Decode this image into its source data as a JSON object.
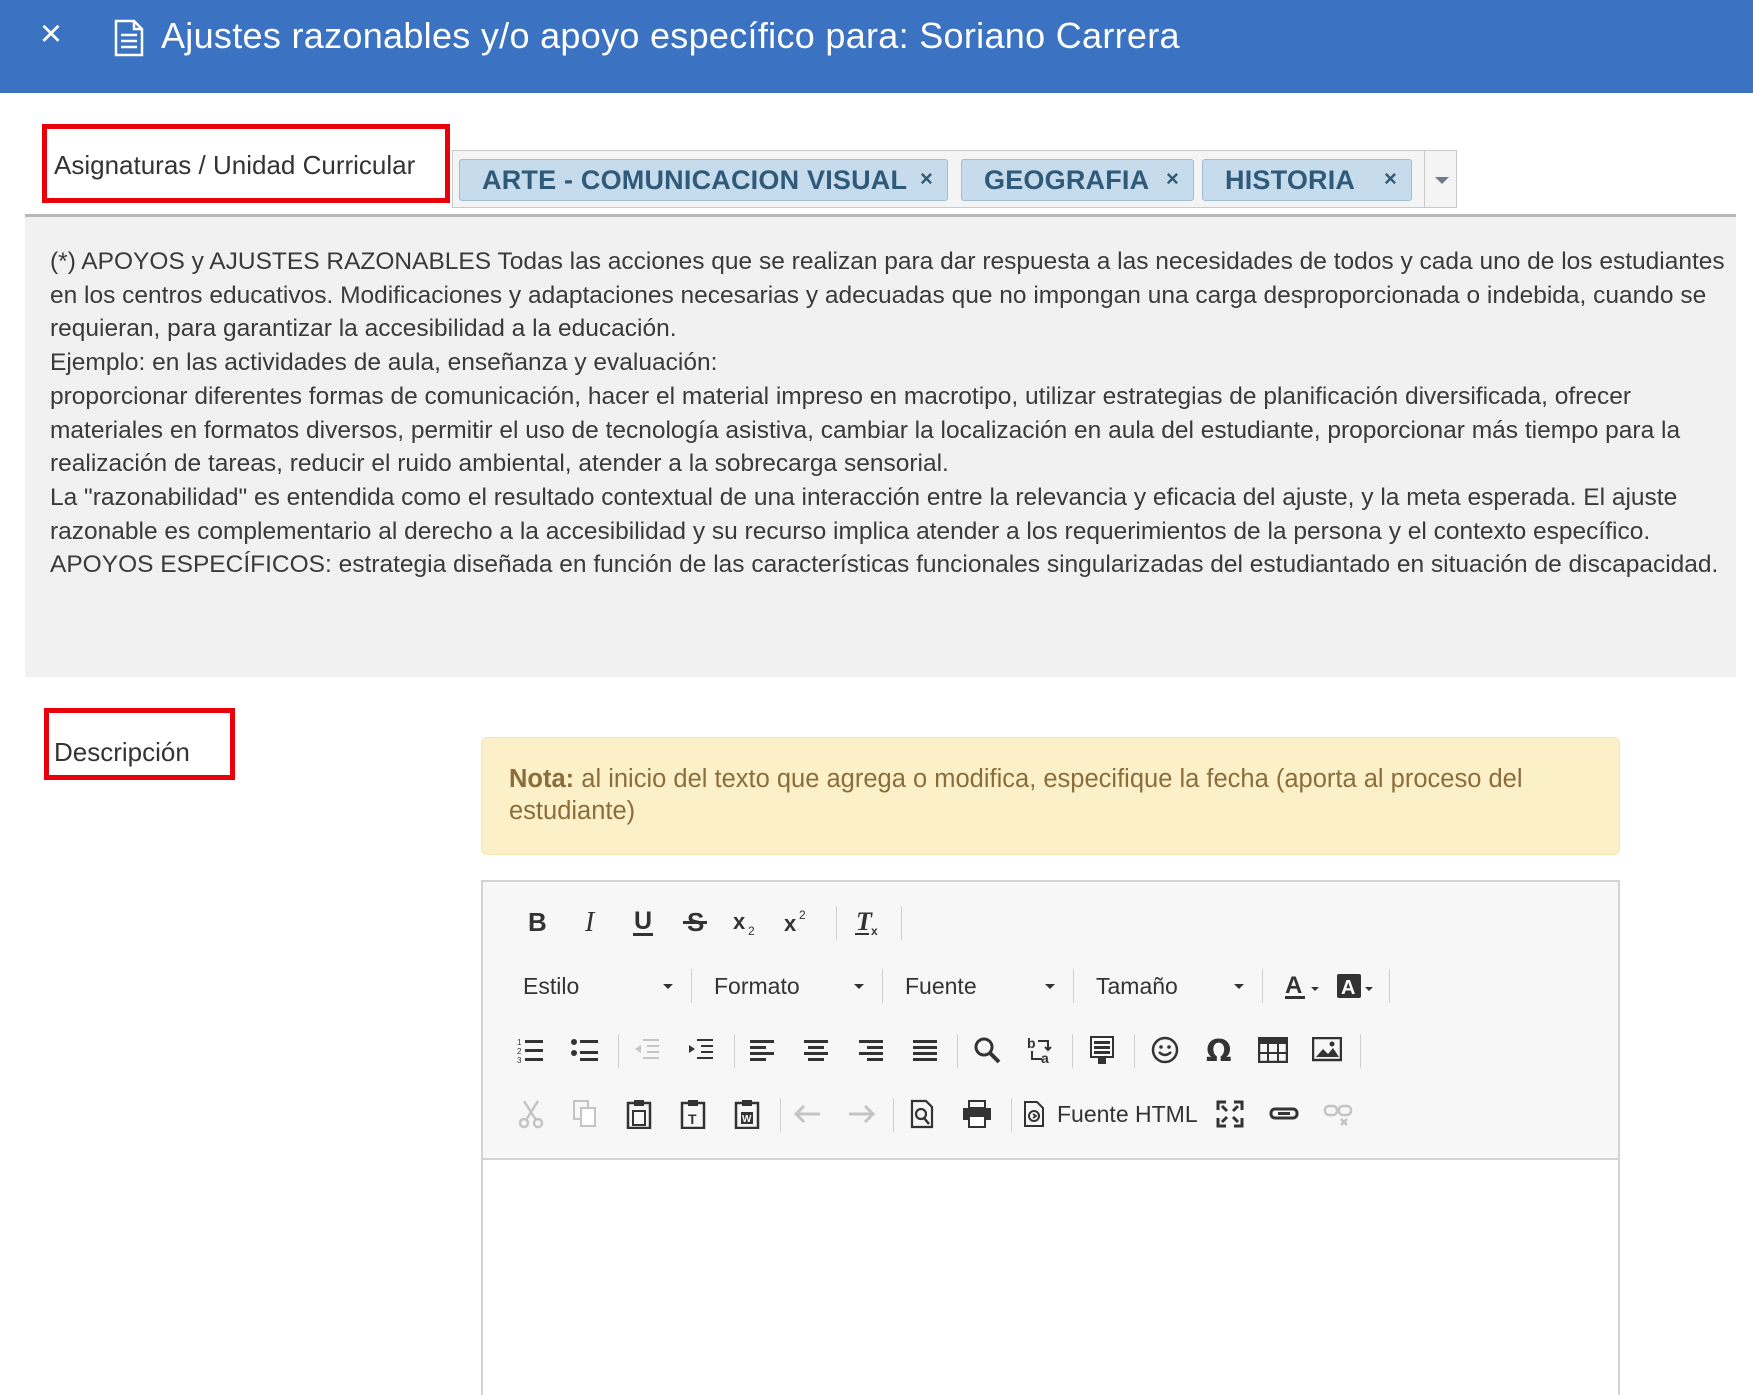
{
  "header": {
    "title": "Ajustes razonables y/o apoyo específico para:  Soriano Carrera",
    "close_glyph": "×",
    "background": "#3b73c2"
  },
  "subjects_field": {
    "label": "Asignaturas / Unidad Curricular",
    "chips": [
      {
        "label": "ARTE - COMUNICACION VISUAL",
        "remove": "×"
      },
      {
        "label": "GEOGRAFIA",
        "remove": "×"
      },
      {
        "label": "HISTORIA",
        "remove": "×"
      }
    ]
  },
  "info": {
    "paragraphs": [
      "(*) APOYOS y AJUSTES RAZONABLES Todas las acciones que se realizan para dar respuesta a las necesidades de todos y cada uno de los estudiantes en los centros educativos. Modificaciones y adaptaciones necesarias y adecuadas que no impongan una carga desproporcionada o indebida, cuando se requieran, para garantizar la accesibilidad a la educación.",
      "Ejemplo: en las actividades de aula, enseñanza y evaluación:",
      "proporcionar diferentes formas de comunicación, hacer el material impreso en macrotipo, utilizar estrategias de planificación diversificada, ofrecer materiales en formatos diversos, permitir el uso de tecnología asistiva, cambiar la localización en aula del estudiante, proporcionar más tiempo para la realización de tareas, reducir el ruido ambiental, atender a la sobrecarga sensorial.",
      "La \"razonabilidad\" es entendida como el resultado contextual de una interacción entre la relevancia y eficacia del ajuste, y la meta esperada. El ajuste razonable es complementario al derecho a la accesibilidad y su recurso implica atender a los requerimientos de la persona y el contexto específico.",
      "APOYOS ESPECÍFICOS: estrategia diseñada en función de las características funcionales singularizadas del estudiantado en situación de discapacidad."
    ]
  },
  "description_field": {
    "label": "Descripción"
  },
  "note": {
    "bold": "Nota:",
    "text": " al inicio del texto que agrega o modifica, especifique la fecha (aporta al proceso del estudiante)"
  },
  "editor": {
    "combos": {
      "style": "Estilo",
      "format": "Formato",
      "font": "Fuente",
      "size": "Tamaño"
    },
    "source_label": "Fuente HTML",
    "content": ""
  },
  "colors": {
    "highlight_box": "#e8000b",
    "chip_bg": "#c6dbeb",
    "note_bg": "#fcf0c9",
    "panel_bg": "#f1f1f1"
  }
}
